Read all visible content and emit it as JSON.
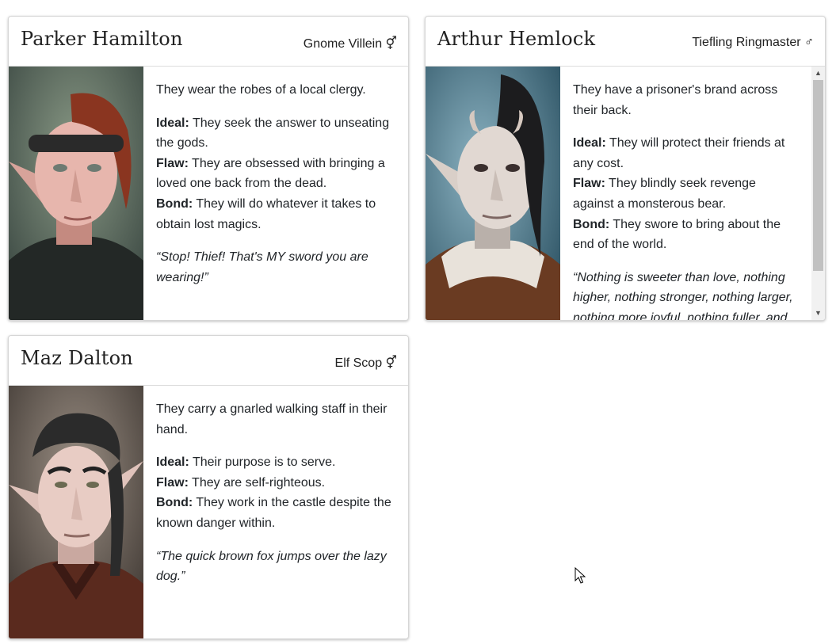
{
  "cards": [
    {
      "name": "Parker Hamilton",
      "race_class": "Gnome Villein ⚥",
      "appearance": "They wear the robes of a local clergy.",
      "ideal_label": "Ideal:",
      "ideal": " They seek the answer to unseating the gods.",
      "flaw_label": "Flaw:",
      "flaw": " They are obsessed with bringing a loved one back from the dead.",
      "bond_label": "Bond:",
      "bond": " They will do whatever it takes to obtain lost magics.",
      "quote": "“Stop! Thief! That's MY sword you are wearing!”"
    },
    {
      "name": "Arthur Hemlock",
      "race_class": "Tiefling Ringmaster ♂",
      "appearance": "They have a prisoner's brand across their back.",
      "ideal_label": "Ideal:",
      "ideal": " They will protect their friends at any cost.",
      "flaw_label": "Flaw:",
      "flaw": " They blindly seek revenge against a monsterous bear.",
      "bond_label": "Bond:",
      "bond": " They swore to bring about the end of the world.",
      "quote": "“Nothing is sweeter than love, nothing higher, nothing stronger, nothing larger, nothing more joyful, nothing fuller, and"
    },
    {
      "name": "Maz Dalton",
      "race_class": "Elf Scop ⚥",
      "appearance": "They carry a gnarled walking staff in their hand.",
      "ideal_label": "Ideal:",
      "ideal": " Their purpose is to serve.",
      "flaw_label": "Flaw:",
      "flaw": " They are self-righteous.",
      "bond_label": "Bond:",
      "bond": " They work in the castle despite the known danger within.",
      "quote": "“The quick brown fox jumps over the lazy dog.”"
    }
  ],
  "scrollbar": {
    "up": "▲",
    "down": "▼"
  }
}
